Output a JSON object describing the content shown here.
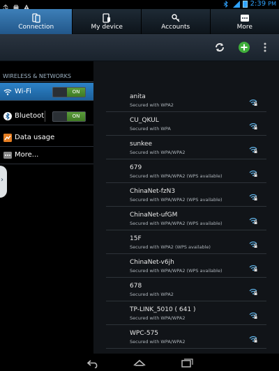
{
  "status_bar": {
    "time": "2:39",
    "ampm": "PM",
    "icons_left": [
      "usb-icon",
      "bag-icon",
      "warning-icon"
    ],
    "icons_right": [
      "bluetooth-icon",
      "signal-icon",
      "battery-icon"
    ]
  },
  "tabs": [
    {
      "label": "Connection",
      "icon": "connection-icon",
      "active": true
    },
    {
      "label": "My device",
      "icon": "device-icon",
      "active": false
    },
    {
      "label": "Accounts",
      "icon": "key-icon",
      "active": false
    },
    {
      "label": "More",
      "icon": "grid-icon",
      "active": false
    }
  ],
  "action_bar": {
    "buttons": [
      "refresh-icon",
      "add-icon",
      "overflow-icon"
    ]
  },
  "left_pane": {
    "section_header": "WIRELESS & NETWORKS",
    "items": [
      {
        "label": "Wi-Fi",
        "icon": "wifi-icon",
        "toggle": "ON"
      },
      {
        "label": "Bluetoot",
        "icon": "bluetooth-icon",
        "toggle": "ON"
      },
      {
        "label": "Data usage",
        "icon": "data-usage-icon"
      },
      {
        "label": "More...",
        "icon": "more-icon"
      }
    ]
  },
  "wifi_networks": [
    {
      "name": "anita",
      "security": "Secured with WPA2"
    },
    {
      "name": "CU_QKUL",
      "security": "Secured with WPA"
    },
    {
      "name": "sunkee",
      "security": "Secured with WPA/WPA2"
    },
    {
      "name": "679",
      "security": "Secured with WPA/WPA2 (WPS available)"
    },
    {
      "name": "ChinaNet-fzN3",
      "security": "Secured with WPA/WPA2 (WPS available)"
    },
    {
      "name": "ChinaNet-ufGM",
      "security": "Secured with WPA/WPA2 (WPS available)"
    },
    {
      "name": "15F",
      "security": "Secured with WPA2 (WPS available)"
    },
    {
      "name": "ChinaNet-v6jh",
      "security": "Secured with WPA/WPA2 (WPS available)"
    },
    {
      "name": "678",
      "security": "Secured with WPA2"
    },
    {
      "name": "TP-LINK_5010 ( 641 )",
      "security": "Secured with WPA/WPA2"
    },
    {
      "name": "WPC-575",
      "security": "Secured with WPA/WPA2"
    }
  ],
  "nav_bar": {
    "buttons": [
      "back-icon",
      "home-icon",
      "recent-apps-icon"
    ]
  },
  "colors": {
    "accent": "#2d83c9",
    "toggle_on": "#4c8c2e",
    "status_blue": "#2fa3ff"
  }
}
